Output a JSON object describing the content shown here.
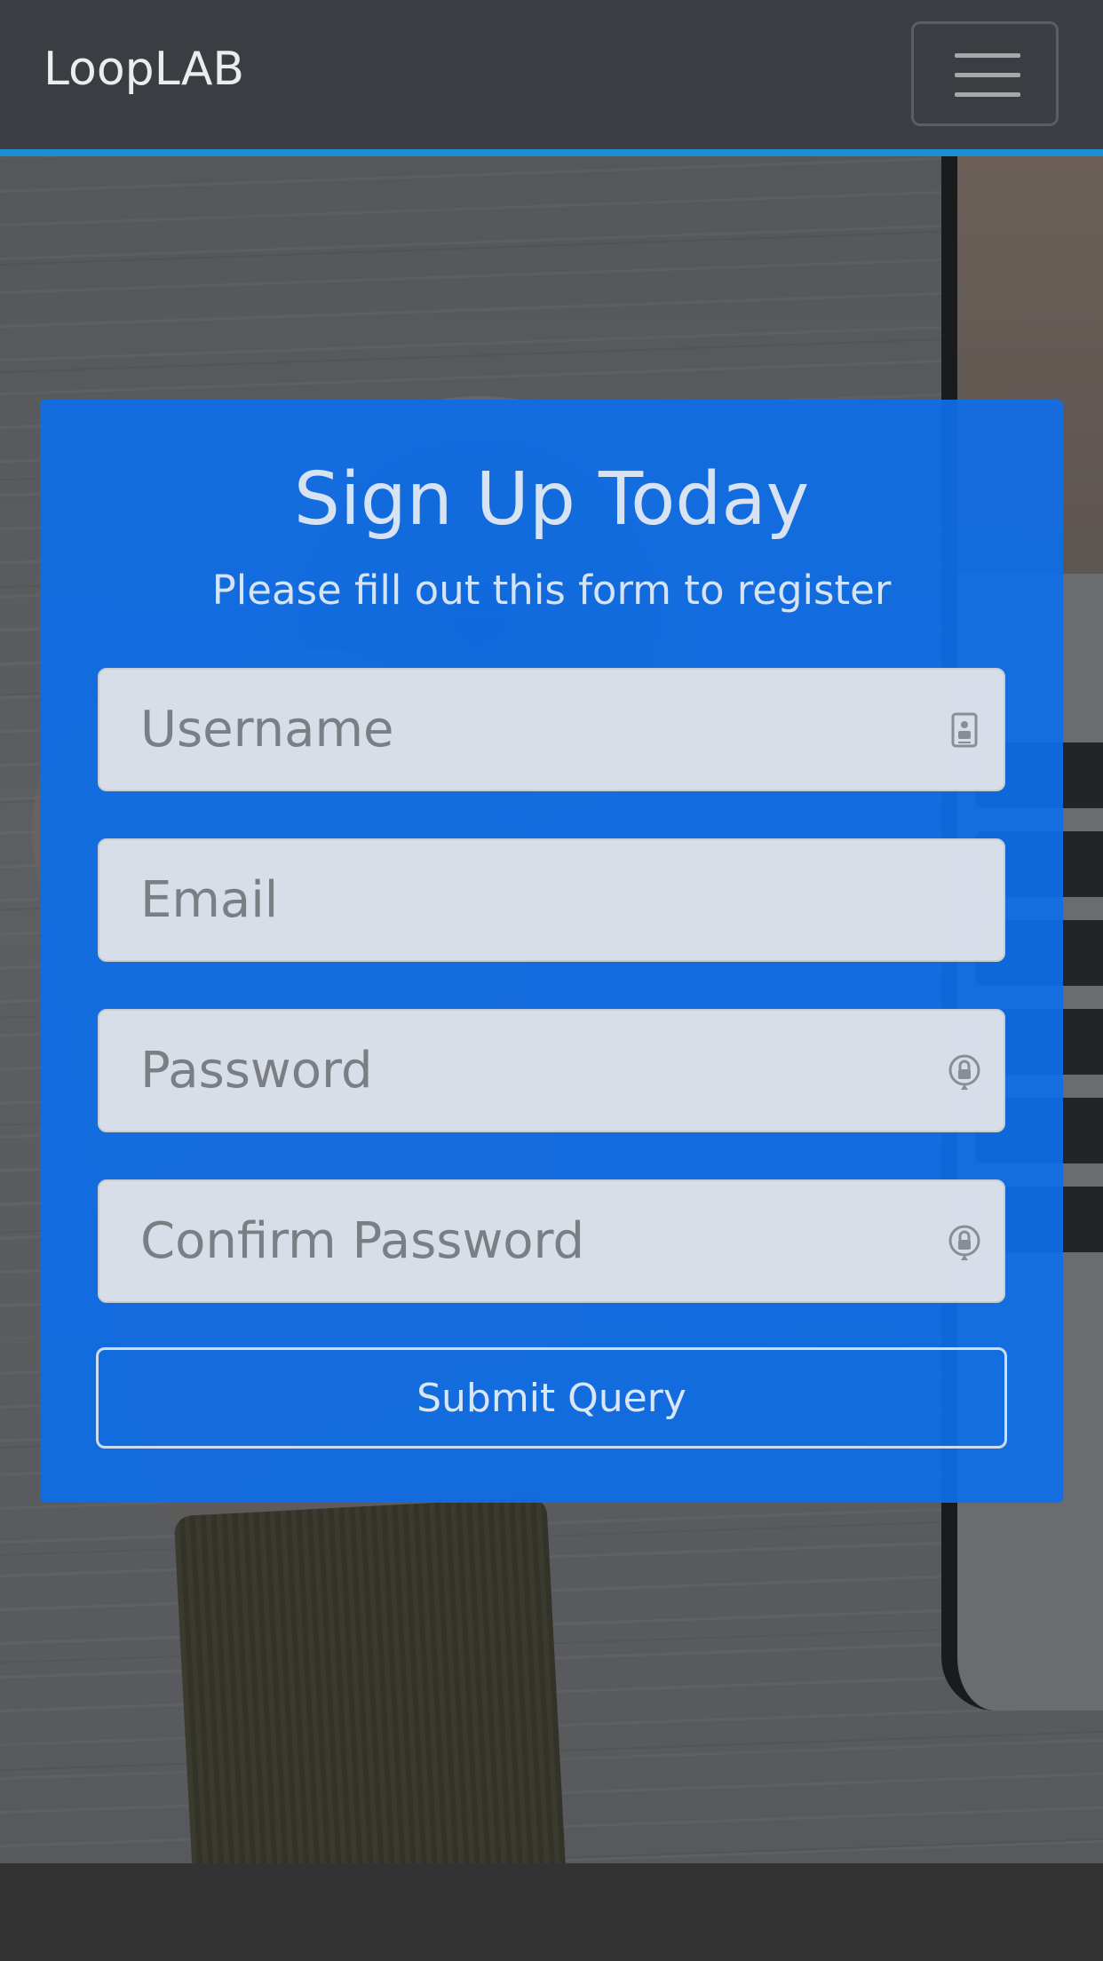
{
  "navbar": {
    "brand": "LoopLAB",
    "menu_icon": "hamburger-menu-icon"
  },
  "signup": {
    "title": "Sign Up Today",
    "subtitle": "Please fill out this form to register",
    "username_placeholder": "Username",
    "username_icon": "contact-card-icon",
    "email_placeholder": "Email",
    "password_placeholder": "Password",
    "password_icon": "password-reveal-icon",
    "confirm_placeholder": "Confirm Password",
    "confirm_icon": "password-reveal-icon",
    "submit_label": "Submit Query"
  },
  "colors": {
    "navbar_bg": "#3a3d42",
    "navbar_accent": "#1b8fd0",
    "panel_bg": "#0e6ee8",
    "footer_bg": "#333333"
  }
}
